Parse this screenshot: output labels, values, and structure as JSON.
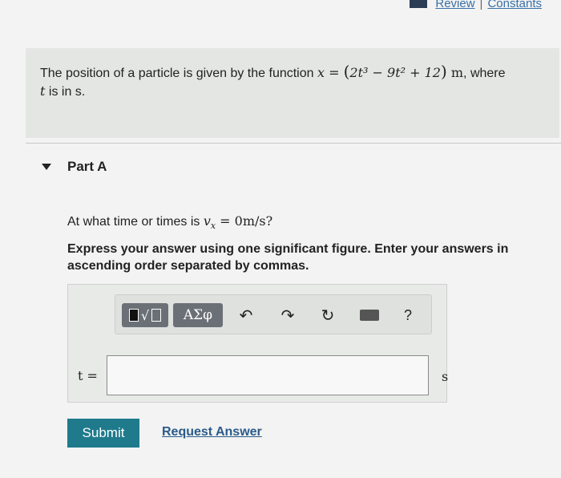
{
  "top_links": {
    "review": "Review",
    "separator": "|",
    "constants": "Constants"
  },
  "problem": {
    "text_before": "The position of a particle is given by the function ",
    "var_x": "x",
    "equals": " = ",
    "open_paren": "(",
    "expression": "2t³ − 9t² + 12",
    "close_paren": ")",
    "unit_m": " m",
    "text_after": ", where",
    "line2_var": "t",
    "line2_text": " is in s."
  },
  "part": {
    "label": "Part A"
  },
  "question": {
    "prefix": "At what time or times is ",
    "var": "v",
    "sub": "x",
    "suffix": " = 0m/s?"
  },
  "instructions": "Express your answer using one significant figure. Enter your answers in ascending order separated by commas.",
  "toolbar": {
    "greek": "ΑΣφ",
    "undo": "↶",
    "redo": "↷",
    "reset": "↻",
    "help": "?"
  },
  "answer": {
    "label": "t =",
    "value": "",
    "unit": "s"
  },
  "actions": {
    "submit": "Submit",
    "request": "Request Answer"
  },
  "icons": {
    "reference": "reference-icon",
    "template": "template-icon",
    "keyboard": "keyboard-icon"
  }
}
